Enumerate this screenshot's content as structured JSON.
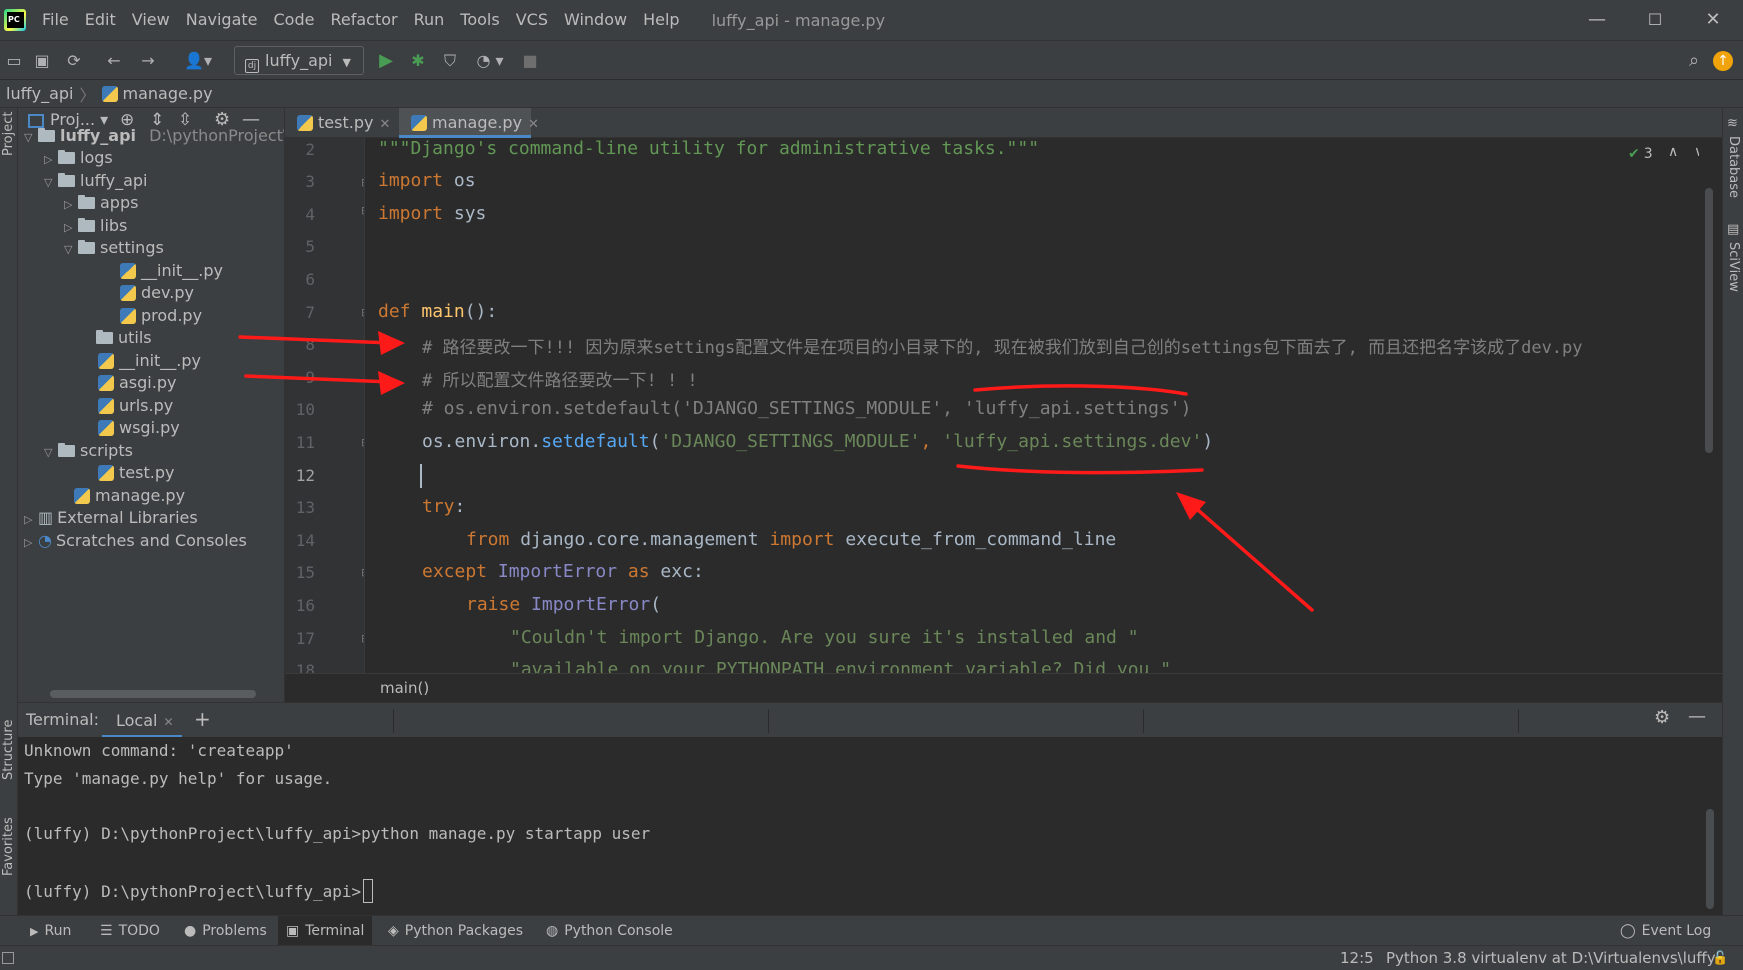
{
  "window": {
    "menu": [
      "File",
      "Edit",
      "View",
      "Navigate",
      "Code",
      "Refactor",
      "Run",
      "Tools",
      "VCS",
      "Window",
      "Help"
    ],
    "title": "luffy_api - manage.py",
    "minimize": "—",
    "maximize": "☐",
    "close": "✕"
  },
  "toolbar": {
    "run_config": "luffy_api"
  },
  "breadcrumb": {
    "project": "luffy_api",
    "file": "manage.py"
  },
  "sidebar": {
    "project_tab": "Project",
    "structure_tab": "Structure",
    "favorites_tab": "Favorites"
  },
  "right_sidebar": {
    "database": "Database",
    "sciview": "SciView"
  },
  "project": {
    "selector": "Proj...",
    "root_name": "luffy_api",
    "root_path": "D:\\pythonProject\\lu",
    "tree": [
      {
        "label": "logs"
      },
      {
        "label": "luffy_api"
      },
      {
        "label": "apps"
      },
      {
        "label": "libs"
      },
      {
        "label": "settings"
      },
      {
        "label": "__init__.py"
      },
      {
        "label": "dev.py"
      },
      {
        "label": "prod.py"
      },
      {
        "label": "utils"
      },
      {
        "label": "__init__.py"
      },
      {
        "label": "asgi.py"
      },
      {
        "label": "urls.py"
      },
      {
        "label": "wsgi.py"
      },
      {
        "label": "scripts"
      },
      {
        "label": "test.py"
      },
      {
        "label": "manage.py"
      },
      {
        "label": "External Libraries"
      },
      {
        "label": "Scratches and Consoles"
      }
    ]
  },
  "editor": {
    "tabs": [
      {
        "label": "test.py"
      },
      {
        "label": "manage.py"
      }
    ],
    "inspection_count": "3",
    "line_numbers": [
      "2",
      "3",
      "4",
      "5",
      "6",
      "7",
      "8",
      "9",
      "10",
      "11",
      "12",
      "13",
      "14",
      "15",
      "16",
      "17",
      "18"
    ],
    "code": {
      "l2": "\"\"\"Django's command-line utility for administrative tasks.\"\"\"",
      "l3_kw": "import",
      "l3_mod": " os",
      "l4_kw": "import",
      "l4_mod": " sys",
      "l7_kw": "def",
      "l7_fn": " main",
      "l7_rest": "():",
      "l8": "# 路径要改一下!!! 因为原来settings配置文件是在项目的小目录下的, 现在被我们放到自己创的settings包下面去了, 而且还把名字该成了dev.py",
      "l9": "# 所以配置文件路径要改一下! ! !",
      "l10": "# os.environ.setdefault('DJANGO_SETTINGS_MODULE', 'luffy_api.settings')",
      "l11_a": "os.environ.",
      "l11_b": "setdefault",
      "l11_c": "(",
      "l11_d": "'DJANGO_SETTINGS_MODULE'",
      "l11_e": ", ",
      "l11_f": "'luffy_api.settings.dev'",
      "l11_g": ")",
      "l13_kw": "try",
      "l13_rest": ":",
      "l14_a": "from",
      "l14_b": " django.core.management ",
      "l14_c": "import",
      "l14_d": " execute_from_command_line",
      "l15_a": "except",
      "l15_b": " ImportError",
      "l15_c": " as",
      "l15_d": " exc:",
      "l16_a": "raise",
      "l16_b": " ImportError",
      "l16_c": "(",
      "l17": "\"Couldn't import Django. Are you sure it's installed and \"",
      "l18": "\"available on your PYTHONPATH environment variable? Did you \""
    },
    "footer": "main()"
  },
  "terminal": {
    "label": "Terminal:",
    "tab": "Local",
    "lines": [
      "Unknown command: 'createapp'",
      "Type 'manage.py help' for usage.",
      "(luffy) D:\\pythonProject\\luffy_api>python manage.py startapp user",
      "(luffy) D:\\pythonProject\\luffy_api>"
    ]
  },
  "bottom_tools": [
    "Run",
    "TODO",
    "Problems",
    "Terminal",
    "Python Packages",
    "Python Console"
  ],
  "event_log": "Event Log",
  "status": {
    "position": "12:5",
    "interpreter": "Python 3.8 virtualenv at D:\\Virtualenvs\\luffy"
  },
  "colors": {
    "background": "#2b2b2b",
    "panel": "#3c3f41",
    "keyword": "#cc7832",
    "string": "#6a8759",
    "comment": "#808080",
    "function": "#ffc66d",
    "annotation": "#ff1a1a"
  }
}
